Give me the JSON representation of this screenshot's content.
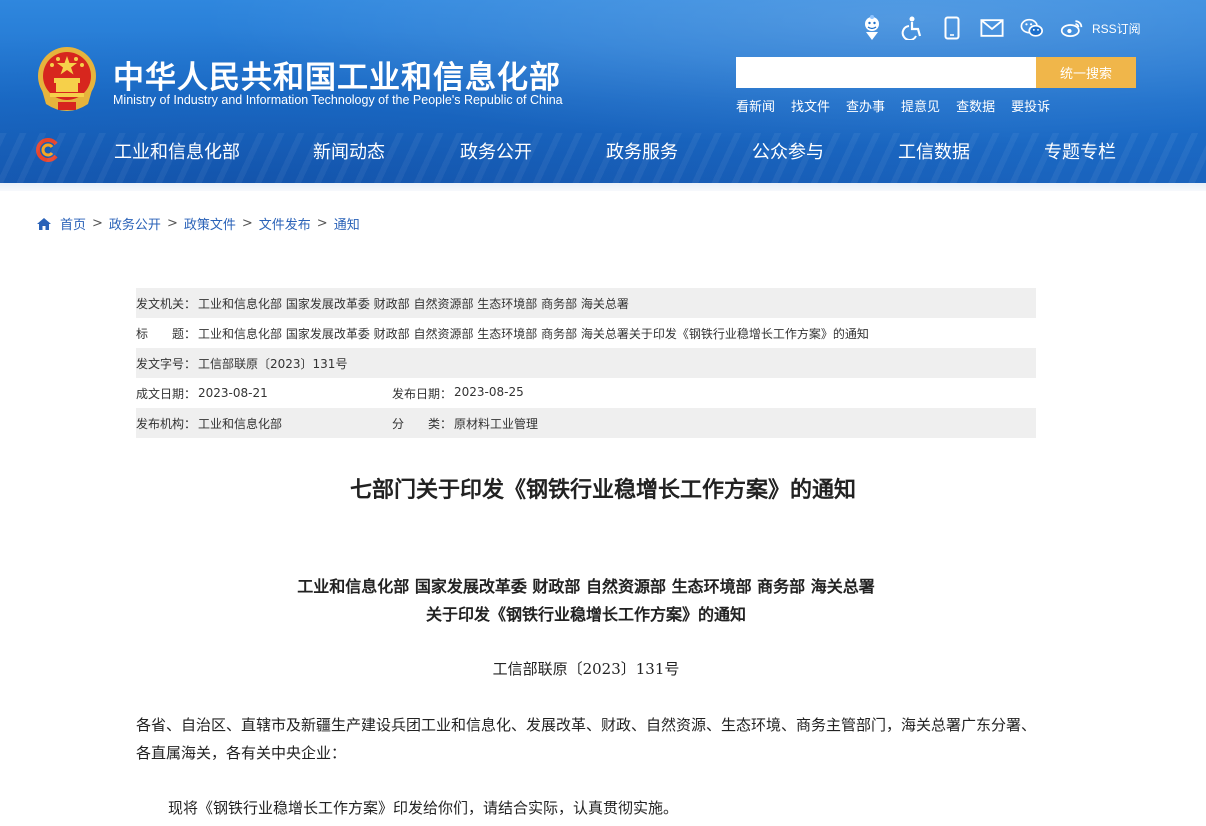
{
  "header": {
    "site_name_cn": "中华人民共和国工业和信息化部",
    "site_name_en": "Ministry of Industry and Information Technology of the People's Republic of China",
    "accent_color": "#1c6fcb",
    "utility_icons": [
      "elderly-mode-icon",
      "accessibility-icon",
      "mobile-icon",
      "mail-icon",
      "wechat-icon",
      "weibo-icon"
    ],
    "rss_label": "RSS订阅",
    "search": {
      "placeholder": "",
      "button_label": "统一搜索",
      "button_color": "#f0b64a"
    },
    "quick_links": [
      "看新闻",
      "找文件",
      "查办事",
      "提意见",
      "查数据",
      "要投诉"
    ]
  },
  "nav": {
    "items": [
      "工业和信息化部",
      "新闻动态",
      "政务公开",
      "政务服务",
      "公众参与",
      "工信数据",
      "专题专栏"
    ]
  },
  "breadcrumb": [
    "首页",
    "政务公开",
    "政策文件",
    "文件发布",
    "通知"
  ],
  "meta": {
    "issuer_label": "发文机关：",
    "issuer_value": "工业和信息化部 国家发展改革委 财政部 自然资源部 生态环境部 商务部 海关总署",
    "title_label": "标　　题：",
    "title_value": "工业和信息化部 国家发展改革委 财政部 自然资源部 生态环境部 商务部 海关总署关于印发《钢铁行业稳增长工作方案》的通知",
    "docno_label": "发文字号：",
    "docno_value": "工信部联原〔2023〕131号",
    "created_label": "成文日期：",
    "created_value": "2023-08-21",
    "published_label": "发布日期：",
    "published_value": "2023-08-25",
    "org_label": "发布机构：",
    "org_value": "工业和信息化部",
    "category_label": "分　　类：",
    "category_value": "原材料工业管理"
  },
  "article": {
    "title": "七部门关于印发《钢铁行业稳增长工作方案》的通知",
    "issuers_line": "工业和信息化部  国家发展改革委  财政部  自然资源部  生态环境部  商务部  海关总署",
    "subject_line": "关于印发《钢铁行业稳增长工作方案》的通知",
    "doc_number": "工信部联原〔2023〕131号",
    "salutation": "各省、自治区、直辖市及新疆生产建设兵团工业和信息化、发展改革、财政、自然资源、生态环境、商务主管部门，海关总署广东分署、各直属海关，各有关中央企业：",
    "body": "现将《钢铁行业稳增长工作方案》印发给你们，请结合实际，认真贯彻实施。"
  }
}
